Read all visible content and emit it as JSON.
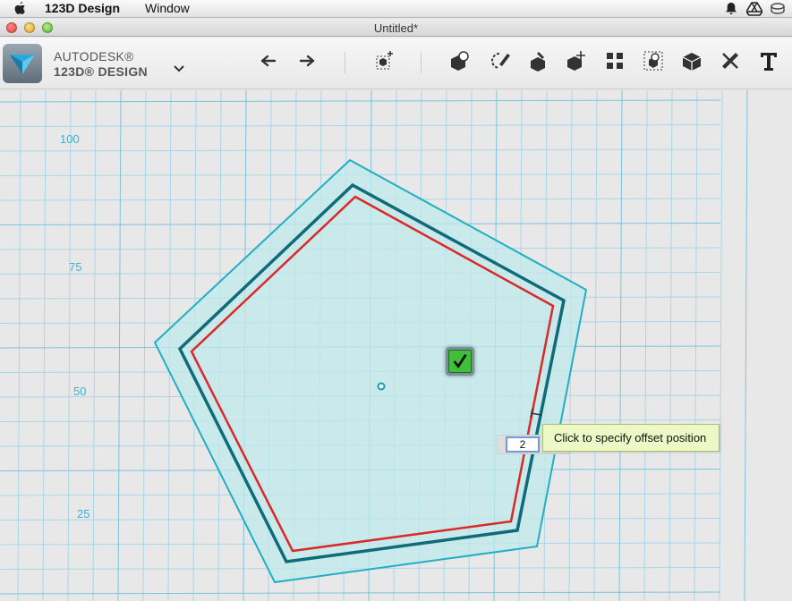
{
  "menubar": {
    "app_name": "123D Design",
    "menu_window": "Window",
    "icons": [
      "apple-icon",
      "notification-bell-icon",
      "google-drive-icon",
      "cloud-drive-icon"
    ]
  },
  "window": {
    "title": "Untitled*",
    "controls": [
      "close",
      "minimize",
      "zoom"
    ]
  },
  "toolbar": {
    "brand_line1": "AUTODESK®",
    "brand_line2": "123D® DESIGN",
    "tools": [
      "undo-icon",
      "redo-icon",
      "transform-icon",
      "primitives-icon",
      "sketch-icon",
      "construct-icon",
      "modify-icon",
      "pattern-icon",
      "grouping-icon",
      "combine-icon",
      "measure-icon",
      "text-icon"
    ]
  },
  "canvas": {
    "grid_labels": [
      "100",
      "75",
      "50",
      "25"
    ],
    "shape": "pentagon",
    "outline_colors": {
      "original": "#0e6b78",
      "offset_inner": "#d92a2a",
      "offset_outer": "#22aec3"
    },
    "offset_value": "2",
    "tooltip": "Click to specify offset position"
  }
}
